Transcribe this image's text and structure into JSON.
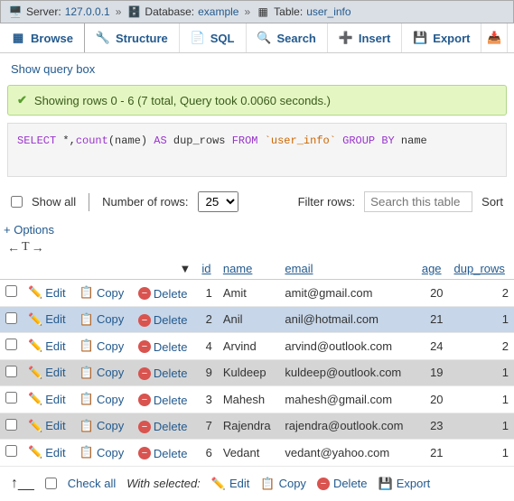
{
  "breadcrumb": {
    "server_label": "Server:",
    "server_value": "127.0.0.1",
    "db_label": "Database:",
    "db_value": "example",
    "table_label": "Table:",
    "table_value": "user_info"
  },
  "tabs": {
    "browse": "Browse",
    "structure": "Structure",
    "sql": "SQL",
    "search": "Search",
    "insert": "Insert",
    "export": "Export"
  },
  "query_box_link": "Show query box",
  "success_msg": "Showing rows 0 - 6 (7 total, Query took 0.0060 seconds.)",
  "sql": {
    "select": "SELECT",
    "star": " *,",
    "count": "count",
    "count_arg": "(name) ",
    "as": "AS",
    "alias": " dup_rows ",
    "from": "FROM",
    "table": "`user_info`",
    "groupby": "GROUP BY",
    "groupcol": " name"
  },
  "controls": {
    "show_all": "Show all",
    "num_rows_label": "Number of rows:",
    "num_rows_value": "25",
    "filter_label": "Filter rows:",
    "search_placeholder": "Search this table",
    "sort_label": "Sort"
  },
  "options_link": "+ Options",
  "headers": {
    "id": "id",
    "name": "name",
    "email": "email",
    "age": "age",
    "dup_rows": "dup_rows"
  },
  "row_actions": {
    "edit": "Edit",
    "copy": "Copy",
    "delete": "Delete"
  },
  "rows": [
    {
      "id": "1",
      "name": "Amit",
      "email": "amit@gmail.com",
      "age": "20",
      "dup_rows": "2",
      "cls": ""
    },
    {
      "id": "2",
      "name": "Anil",
      "email": "anil@hotmail.com",
      "age": "21",
      "dup_rows": "1",
      "cls": "highlight"
    },
    {
      "id": "4",
      "name": "Arvind",
      "email": "arvind@outlook.com",
      "age": "24",
      "dup_rows": "2",
      "cls": ""
    },
    {
      "id": "9",
      "name": "Kuldeep",
      "email": "kuldeep@outlook.com",
      "age": "19",
      "dup_rows": "1",
      "cls": "highlight-grey"
    },
    {
      "id": "3",
      "name": "Mahesh",
      "email": "mahesh@gmail.com",
      "age": "20",
      "dup_rows": "1",
      "cls": ""
    },
    {
      "id": "7",
      "name": "Rajendra",
      "email": "rajendra@outlook.com",
      "age": "23",
      "dup_rows": "1",
      "cls": "highlight-grey"
    },
    {
      "id": "6",
      "name": "Vedant",
      "email": "vedant@yahoo.com",
      "age": "21",
      "dup_rows": "1",
      "cls": ""
    }
  ],
  "footer": {
    "check_all": "Check all",
    "with_selected": "With selected:",
    "edit": "Edit",
    "copy": "Copy",
    "delete": "Delete",
    "export": "Export"
  }
}
